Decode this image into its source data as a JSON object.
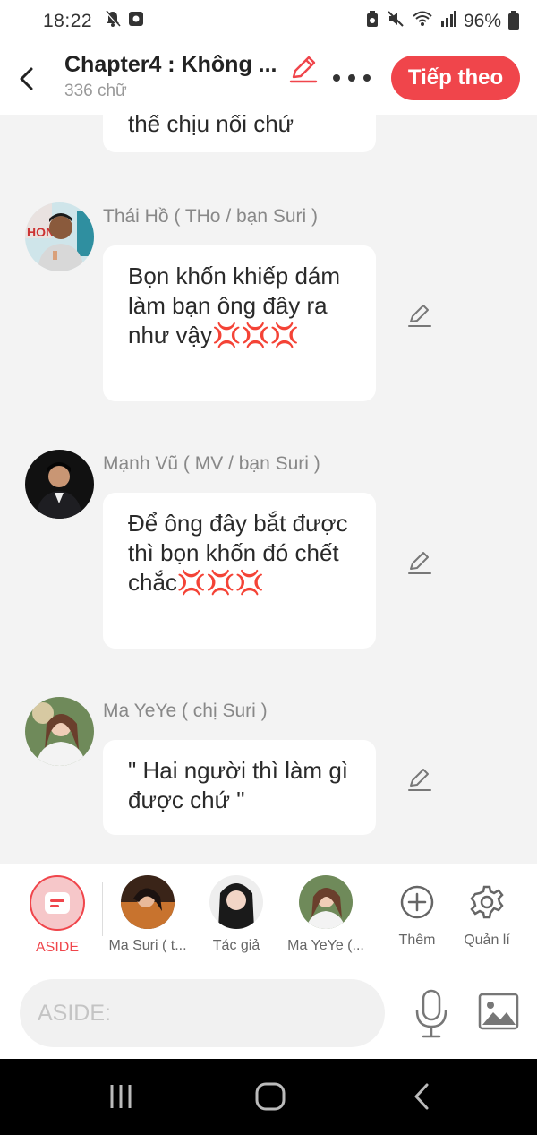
{
  "status_bar": {
    "time": "18:22",
    "battery": "96%"
  },
  "header": {
    "title": "Chapter4 : Không ...",
    "word_count": "336 chữ",
    "next_label": "Tiếp theo"
  },
  "messages": [
    {
      "id": "partial",
      "text": "thế chịu nổi chứ"
    },
    {
      "id": "tho",
      "name": "Thái Hồ ( THo / bạn Suri )",
      "text": "Bọn khốn khiếp dám làm bạn ông đây ra như vậy💢💢💢"
    },
    {
      "id": "mv",
      "name": "Mạnh Vũ ( MV / bạn Suri )",
      "text": "Để ông đây bắt được thì bọn khốn đó chết chắc💢💢💢"
    },
    {
      "id": "yeye",
      "name": "Ma YeYe ( chị Suri )",
      "text": "\" Hai người thì làm gì được chứ \""
    }
  ],
  "cast": [
    {
      "label": "ASIDE"
    },
    {
      "label": "Ma Suri ( t..."
    },
    {
      "label": "Tác giả"
    },
    {
      "label": "Ma YeYe (..."
    },
    {
      "label": "Thêm"
    },
    {
      "label": "Quản lí"
    }
  ],
  "input": {
    "placeholder": "ASIDE:"
  },
  "colors": {
    "accent": "#f0454b"
  }
}
